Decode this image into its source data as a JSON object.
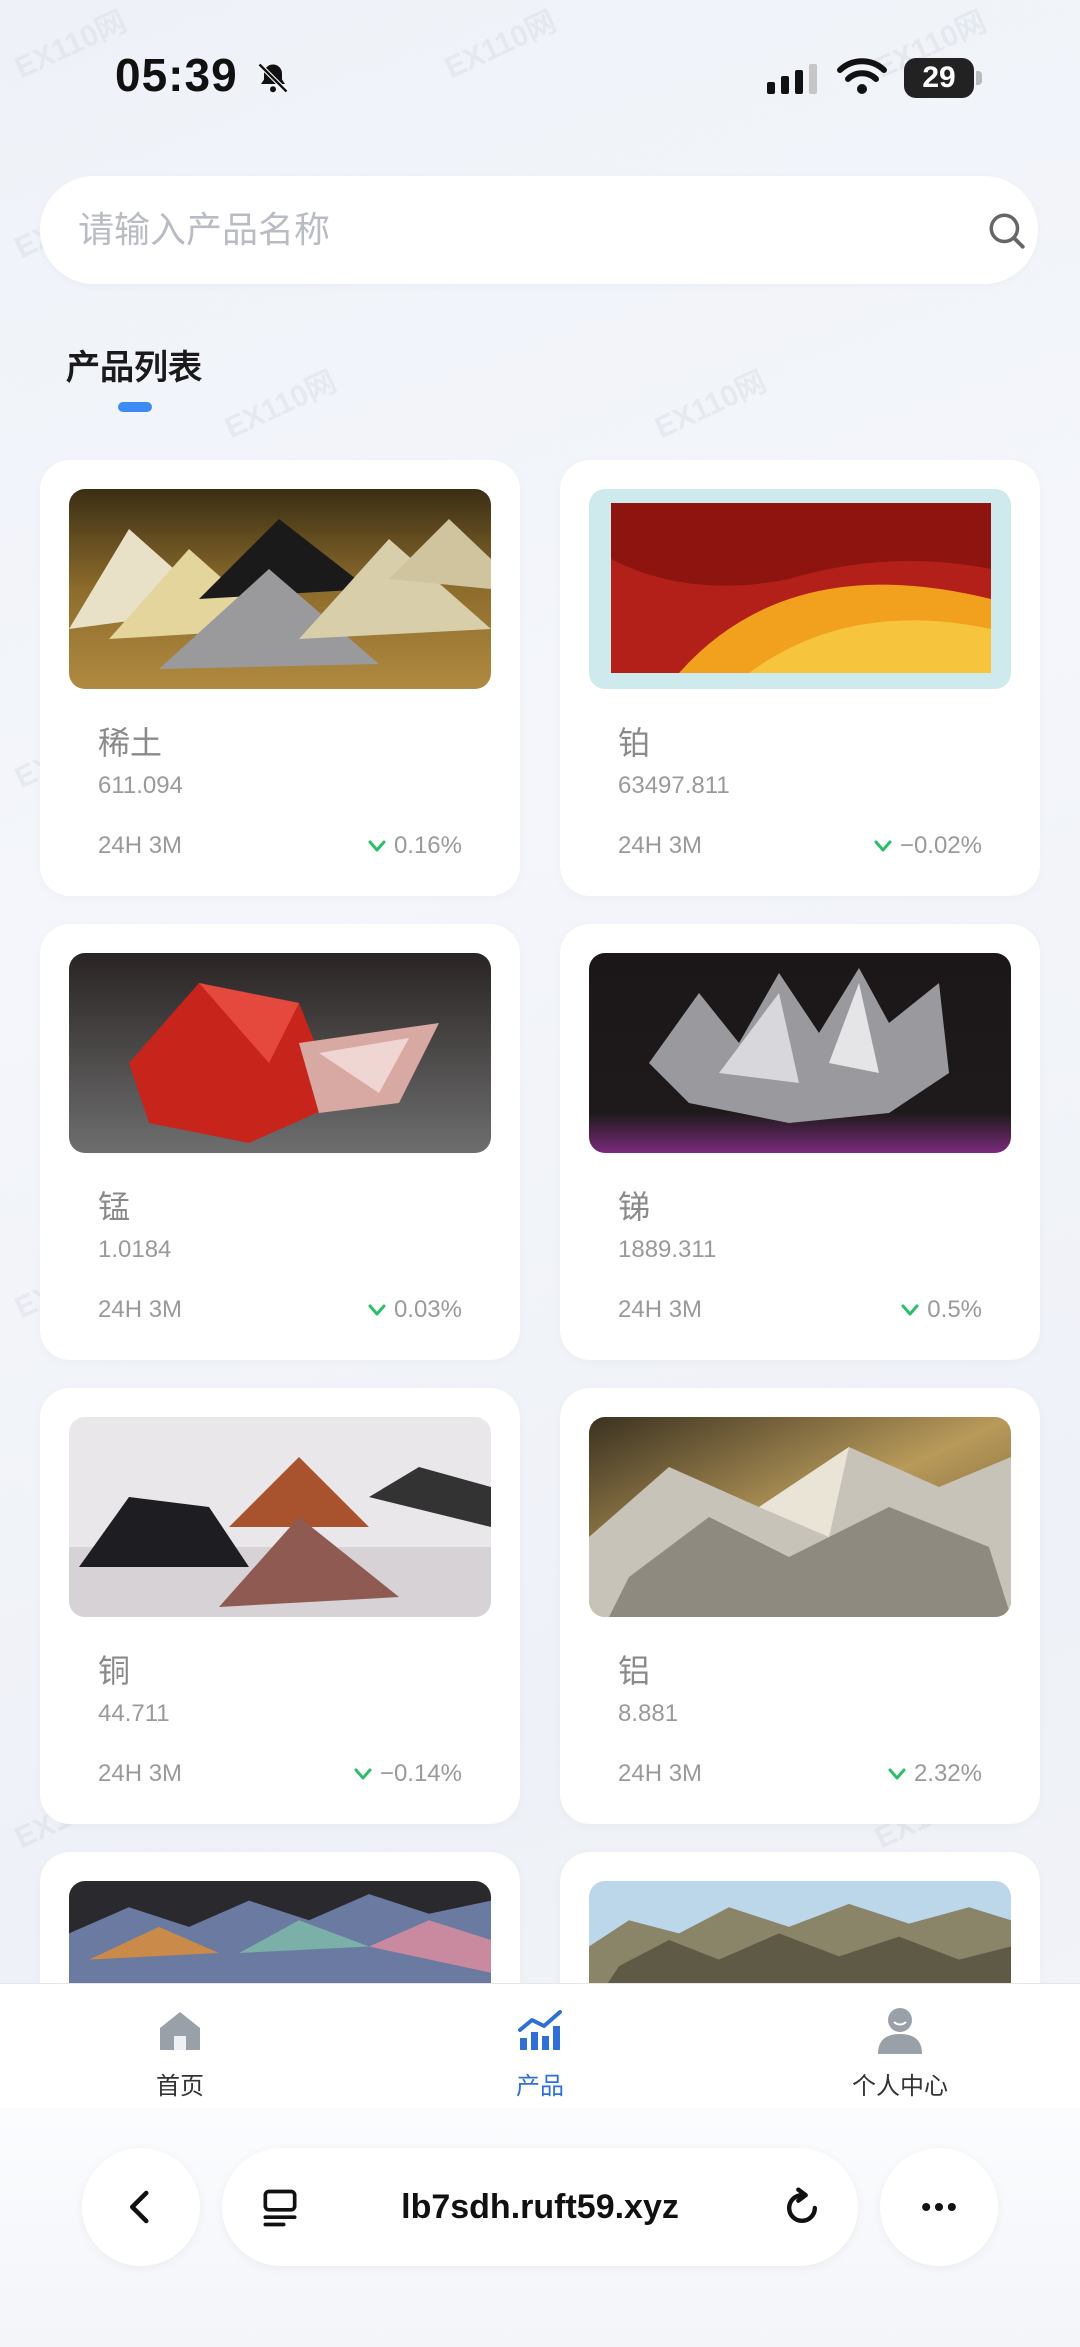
{
  "status_bar": {
    "time": "05:39",
    "battery": "29"
  },
  "search": {
    "placeholder": "请输入产品名称"
  },
  "section": {
    "title": "产品列表"
  },
  "products": [
    {
      "name": "稀土",
      "price": "611.094",
      "period": "24H 3M",
      "change": "0.16%"
    },
    {
      "name": "铂",
      "price": "63497.811",
      "period": "24H 3M",
      "change": "−0.02%"
    },
    {
      "name": "锰",
      "price": "1.0184",
      "period": "24H 3M",
      "change": "0.03%"
    },
    {
      "name": "锑",
      "price": "1889.311",
      "period": "24H 3M",
      "change": "0.5%"
    },
    {
      "name": "铜",
      "price": "44.711",
      "period": "24H 3M",
      "change": "−0.14%"
    },
    {
      "name": "铝",
      "price": "8.881",
      "period": "24H 3M",
      "change": "2.32%"
    }
  ],
  "nav": {
    "home": "首页",
    "products": "产品",
    "profile": "个人中心"
  },
  "browser": {
    "url": "lb7sdh.ruft59.xyz"
  },
  "colors": {
    "accent": "#3d8bf2",
    "up": "#2bbf6a"
  },
  "icons": [
    "bell-muted-icon",
    "search-icon",
    "home-icon",
    "chart-icon",
    "person-icon",
    "back-icon",
    "tabs-icon",
    "reload-icon",
    "more-icon"
  ]
}
